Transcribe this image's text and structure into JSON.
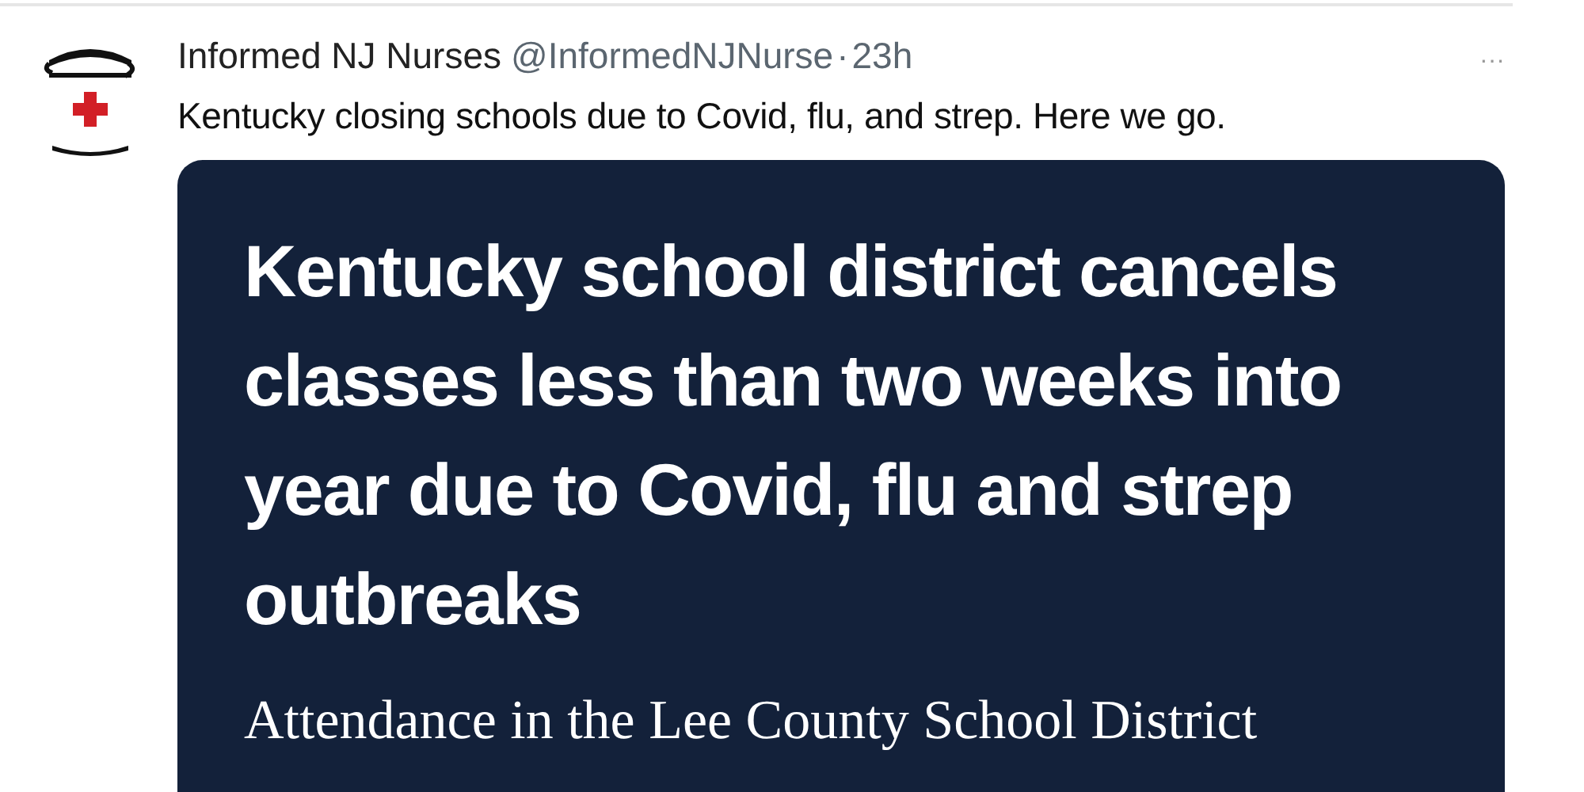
{
  "tweet": {
    "author": {
      "name": "Informed NJ Nurses",
      "handle": "@InformedNJNurse",
      "separator": "·",
      "time": "23h"
    },
    "menu": "···",
    "text": "Kentucky closing schools due to Covid, flu, and strep. Here we go.",
    "card": {
      "headline": "Kentucky school district cancels classes less than two weeks into year due to Covid, flu and strep outbreaks",
      "summary": "Attendance in the Lee County School District"
    }
  }
}
